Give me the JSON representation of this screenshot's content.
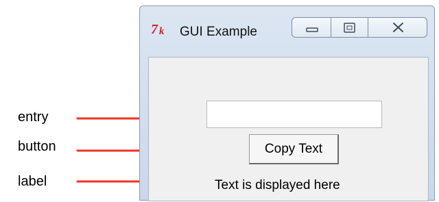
{
  "window": {
    "title": "GUI Example",
    "controls": [
      "minimize",
      "maximize",
      "close"
    ]
  },
  "form": {
    "entry_value": "",
    "button_label": "Copy Text",
    "label_text": "Text is displayed here"
  },
  "annotations": {
    "entry": "entry",
    "button": "button",
    "label": "label"
  },
  "colors": {
    "arrow": "#ee3322",
    "tk_logo": "#d42020"
  },
  "icons": [
    "tk-feather-icon",
    "minimize-icon",
    "maximize-icon",
    "close-icon"
  ]
}
